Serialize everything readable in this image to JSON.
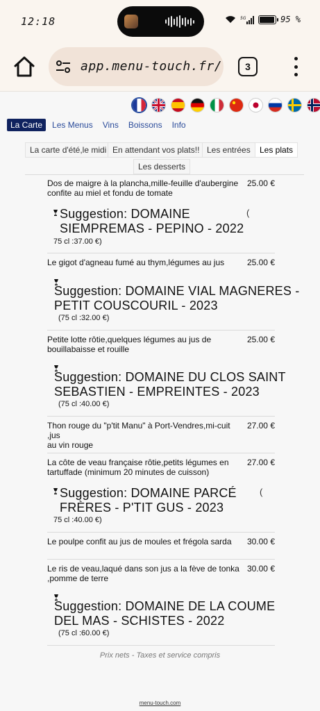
{
  "status": {
    "time": "12:18",
    "network": "5G",
    "battery": "95 %",
    "battery_level": 0.95
  },
  "browser": {
    "url": "app.menu-touch.fr/",
    "tab_count": "3"
  },
  "languages": [
    "fr",
    "en",
    "es",
    "de",
    "it",
    "zh",
    "ja",
    "ru",
    "sv",
    "no"
  ],
  "nav": [
    "La Carte",
    "Les Menus",
    "Vins",
    "Boissons",
    "Info"
  ],
  "subtabs": [
    "La carte d'été,le midi",
    "En attendant vos plats!!",
    "Les entrées",
    "Les plats",
    "Les desserts"
  ],
  "dishes": [
    {
      "name_l1": "Dos de maigre à la plancha,mille-feuille d'aubergine",
      "name_l2": "confite au miel et fondu de tomate",
      "price": "25.00 €",
      "sugg_l1": "Suggestion: DOMAINE",
      "sugg_l2": "SIEMPREMAS - PEPINO - 2022",
      "sugg_price": "75 cl :37.00 €)",
      "paren": "("
    },
    {
      "name_l1": "Le gigot d'agneau fumé au thym,légumes au jus",
      "price": "25.00 €",
      "sugg_l1": "Suggestion: DOMAINE VIAL MAGNERES -",
      "sugg_l2": "PETIT COUSCOURIL - 2023",
      "sugg_price": "(75 cl :32.00 €)"
    },
    {
      "name_l1": "Petite lotte rôtie,quelques légumes au jus de",
      "name_l2": "bouillabaisse et rouille",
      "price": "25.00 €",
      "sugg_l1": "Suggestion: DOMAINE DU CLOS SAINT",
      "sugg_l2": "SEBASTIEN - EMPREINTES - 2023",
      "sugg_price": "(75 cl :40.00 €)"
    },
    {
      "name_l1": "Thon rouge du \"p'tit Manu\" à Port-Vendres,mi-cuit ,jus",
      "name_l2": "au vin rouge",
      "price": "27.00 €"
    },
    {
      "name_l1": "La côte de veau française rôtie,petits légumes en",
      "name_l2": "tartuffade (minimum 20 minutes de cuisson)",
      "price": "27.00 €",
      "sugg_l1": "Suggestion: DOMAINE PARCÉ",
      "sugg_l2": "FRÈRES - P'TIT GUS - 2023",
      "sugg_price": "75 cl :40.00 €)",
      "paren": "("
    },
    {
      "name_l1": "Le poulpe confit au jus de moules et frégola sarda",
      "price": "30.00 €"
    },
    {
      "name_l1": "Le ris de veau,laqué dans son jus a la fève de tonka",
      "name_l2": ",pomme de terre",
      "price": "30.00 €",
      "sugg_l1": "Suggestion: DOMAINE DE LA COUME",
      "sugg_l2": "DEL MAS - SCHISTES - 2022",
      "sugg_price": "(75 cl :60.00 €)"
    }
  ],
  "footer": {
    "note": "Prix nets - Taxes et service compris",
    "brand": "menu-touch.com"
  }
}
